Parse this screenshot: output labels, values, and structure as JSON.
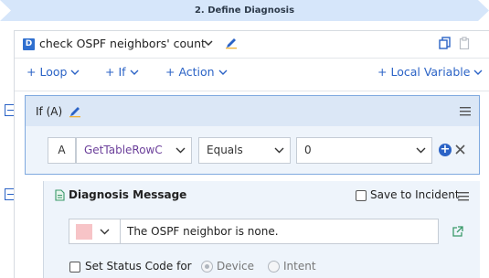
{
  "step_banner": {
    "label": "2. Define Diagnosis"
  },
  "card": {
    "badge": "D",
    "title": "check OSPF neighbors' count",
    "icons": [
      "chevron-down-icon",
      "pencil-icon",
      "copy-icon",
      "clipboard-icon"
    ]
  },
  "toolbar": {
    "loop": "+ Loop",
    "if": "+ If",
    "action": "+ Action",
    "local_variable": "+ Local Variable"
  },
  "if_block": {
    "title": "If (A)",
    "condition": {
      "alias": "A",
      "function": "GetTableRowC",
      "operator": "Equals",
      "value": "0"
    },
    "function_color": "#6b3f9a"
  },
  "diagnosis": {
    "title": "Diagnosis Message",
    "save_to_incident": "Save to Incident",
    "message": "The OSPF neighbor is none.",
    "swatch_color": "#f7c4c7",
    "set_status_label": "Set Status Code for",
    "radio_device": "Device",
    "radio_intent": "Intent",
    "radio_selected": "Device"
  },
  "colors": {
    "accent": "#2b63c6",
    "banner": "#d6e6fa",
    "if_header": "#dbe7f6",
    "block_bg": "#eef4fb"
  }
}
